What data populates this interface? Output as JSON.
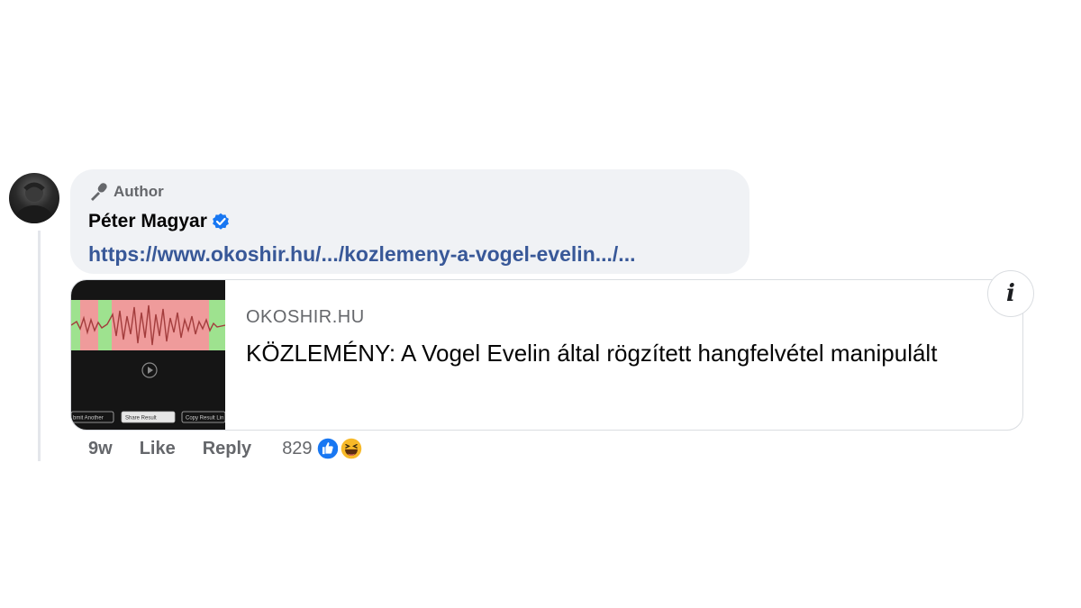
{
  "comment": {
    "author_badge": "Author",
    "author_name": "Péter Magyar",
    "verified": true,
    "link": "https://www.okoshir.hu/.../kozlemeny-a-vogel-evelin.../..."
  },
  "link_preview": {
    "domain": "OKOSHIR.HU",
    "title": "KÖZLEMÉNY: A Vogel Evelin által rögzített hangfelvétel manipulált",
    "thumbnail_buttons": [
      "bmit Another",
      "Share Result",
      "Copy Result Lin"
    ]
  },
  "actions": {
    "time": "9w",
    "like": "Like",
    "reply": "Reply",
    "reaction_count": "829",
    "reactions": [
      "like-icon",
      "haha-icon"
    ]
  },
  "colors": {
    "link": "#385898",
    "bubble": "#f0f2f5",
    "like_blue": "#1877f2",
    "haha_yellow": "#f7b928"
  }
}
